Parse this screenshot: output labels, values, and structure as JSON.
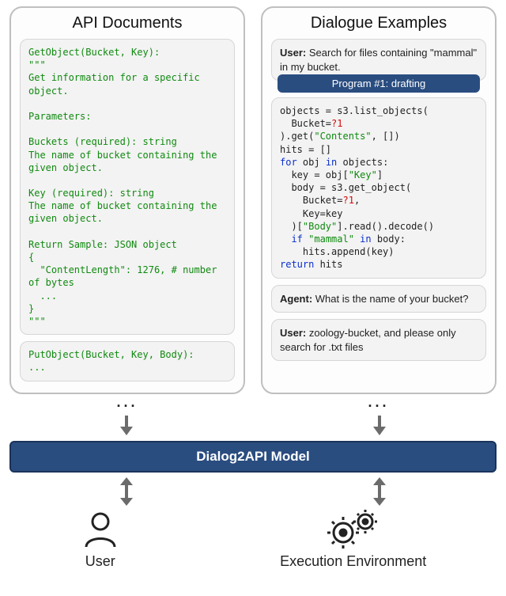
{
  "panels": {
    "api": {
      "title": "API Documents",
      "doc1": "GetObject(Bucket, Key):\n\"\"\"\nGet information for a specific object.\n\nParameters:\n\nBuckets (required): string\nThe name of bucket containing the given object.\n\nKey (required): string\nThe name of bucket containing the given object.\n\nReturn Sample: JSON object\n{\n  \"ContentLength\": 1276, # number of bytes\n  ...\n}\n\"\"\"",
      "doc2": "PutObject(Bucket, Key, Body):\n...",
      "dots": "..."
    },
    "dialog": {
      "title": "Dialogue Examples",
      "user1_label": "User:",
      "user1_text": " Search for files containing \"mammal\" in my bucket.",
      "program_header": "Program #1: drafting",
      "agent_label": "Agent:",
      "agent_text": " What is the name of your bucket?",
      "user2_label": "User:",
      "user2_text": " zoology-bucket, and please only search for .txt files",
      "dots": "..."
    }
  },
  "model_bar": "Dialog2API Model",
  "actors": {
    "user": "User",
    "env": "Execution Environment"
  },
  "chart_data": {
    "type": "diagram",
    "nodes": [
      {
        "id": "api_docs",
        "label": "API Documents",
        "kind": "panel"
      },
      {
        "id": "dialog_examples",
        "label": "Dialogue Examples",
        "kind": "panel"
      },
      {
        "id": "model",
        "label": "Dialog2API Model",
        "kind": "component"
      },
      {
        "id": "user",
        "label": "User",
        "kind": "actor"
      },
      {
        "id": "env",
        "label": "Execution Environment",
        "kind": "actor"
      }
    ],
    "edges": [
      {
        "from": "api_docs",
        "to": "model",
        "direction": "uni"
      },
      {
        "from": "dialog_examples",
        "to": "model",
        "direction": "uni"
      },
      {
        "from": "model",
        "to": "user",
        "direction": "bi"
      },
      {
        "from": "model",
        "to": "env",
        "direction": "bi"
      }
    ],
    "api_doc_sample": {
      "function": "GetObject",
      "params": [
        "Bucket",
        "Key"
      ],
      "description": "Get information for a specific object.",
      "param_docs": [
        {
          "name": "Buckets",
          "required": true,
          "type": "string",
          "desc": "The name of bucket containing the given object."
        },
        {
          "name": "Key",
          "required": true,
          "type": "string",
          "desc": "The name of bucket containing the given object."
        }
      ],
      "return_sample": {
        "ContentLength": 1276
      },
      "next_function": "PutObject(Bucket, Key, Body)"
    },
    "dialogue_sample": {
      "turns": [
        {
          "speaker": "User",
          "text": "Search for files containing \"mammal\" in my bucket."
        },
        {
          "speaker": "Program",
          "label": "Program #1: drafting",
          "code": "objects = s3.list_objects(\n  Bucket=?1\n).get(\"Contents\", [])\nhits = []\nfor obj in objects:\n  key = obj[\"Key\"]\n  body = s3.get_object(\n    Bucket=?1,\n    Key=key\n  )[\"Body\"].read().decode()\n  if \"mammal\" in body:\n    hits.append(key)\nreturn hits"
        },
        {
          "speaker": "Agent",
          "text": "What is the name of your bucket?"
        },
        {
          "speaker": "User",
          "text": "zoology-bucket, and please only search for .txt files"
        }
      ]
    }
  }
}
